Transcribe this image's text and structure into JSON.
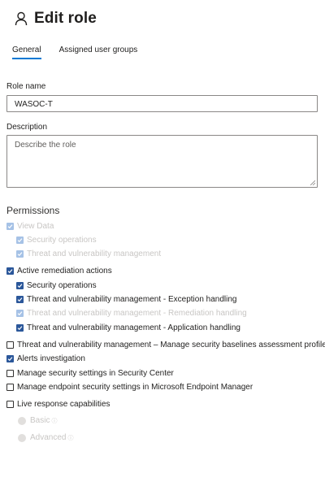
{
  "header": {
    "title": "Edit role",
    "icon": "person-icon"
  },
  "tabs": [
    {
      "label": "General",
      "active": true
    },
    {
      "label": "Assigned user groups",
      "active": false
    }
  ],
  "form": {
    "role_name_label": "Role name",
    "role_name_value": "WASOC-T",
    "description_label": "Description",
    "description_placeholder": "Describe the role"
  },
  "permissions": {
    "title": "Permissions",
    "items": [
      {
        "label": "View Data",
        "checked": true,
        "disabled": true
      },
      {
        "label": "Security operations",
        "checked": true,
        "disabled": true
      },
      {
        "label": "Threat and vulnerability management",
        "checked": true,
        "disabled": true
      },
      {
        "label": "Active remediation actions",
        "checked": true,
        "disabled": false
      },
      {
        "label": "Security operations",
        "checked": true,
        "disabled": false
      },
      {
        "label": "Threat and vulnerability management - Exception handling",
        "checked": true,
        "disabled": false
      },
      {
        "label": "Threat and vulnerability management - Remediation handling",
        "checked": true,
        "disabled": true
      },
      {
        "label": "Threat and vulnerability management - Application handling",
        "checked": true,
        "disabled": false
      },
      {
        "label": "Threat and vulnerability management – Manage security baselines assessment profiles",
        "checked": false,
        "disabled": false
      },
      {
        "label": "Alerts investigation",
        "checked": true,
        "disabled": false
      },
      {
        "label": "Manage security settings in Security Center",
        "checked": false,
        "disabled": false
      },
      {
        "label": "Manage endpoint security settings in Microsoft Endpoint Manager",
        "checked": false,
        "disabled": false
      },
      {
        "label": "Live response capabilities",
        "checked": false,
        "disabled": false
      }
    ],
    "live_response_options": [
      {
        "label": "Basic",
        "disabled": true
      },
      {
        "label": "Advanced",
        "disabled": true
      }
    ]
  },
  "colors": {
    "accent": "#0078d4",
    "checkbox_fill": "#2b579a",
    "disabled_text": "#c8c6c4"
  }
}
